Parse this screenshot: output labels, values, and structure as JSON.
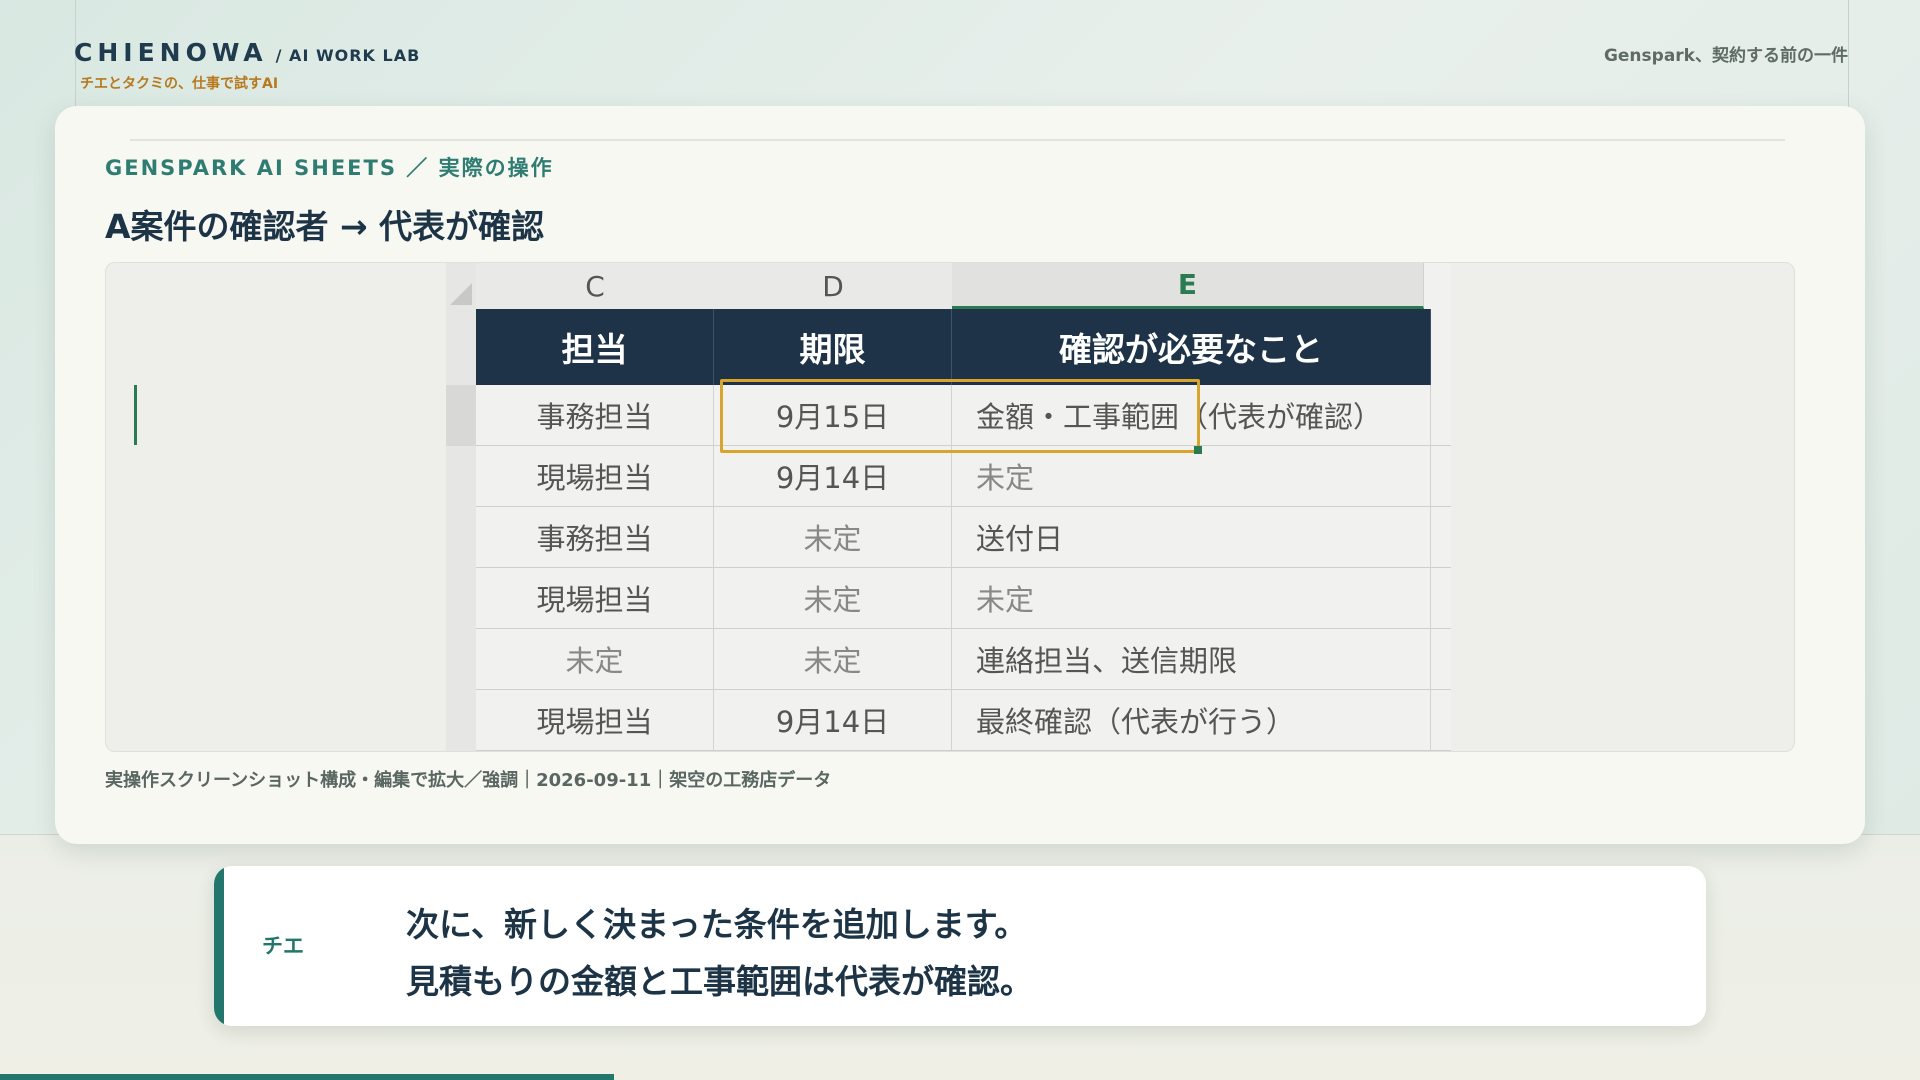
{
  "header": {
    "brand_name": "CHIENOWA",
    "brand_sub": "/ AI WORK LAB",
    "tagline": "チエとタクミの、仕事で試すAI",
    "episode_title": "Genspark、契約する前の一件"
  },
  "slide": {
    "kicker": "GENSPARK AI SHEETS ／ 実際の操作",
    "title": "A案件の確認者 → 代表が確認",
    "caption": "実操作スクリーンショット構成・編集で拡大／強調｜2026-09-11｜架空の工務店データ"
  },
  "sheet": {
    "columns": [
      "C",
      "D",
      "E"
    ],
    "active_column": "E",
    "headers": [
      "担当",
      "期限",
      "確認が必要なこと"
    ],
    "rows": [
      [
        "事務担当",
        "9月15日",
        "金額・工事範囲（代表が確認）"
      ],
      [
        "現場担当",
        "9月14日",
        "未定"
      ],
      [
        "事務担当",
        "未定",
        "送付日"
      ],
      [
        "現場担当",
        "未定",
        "未定"
      ],
      [
        "未定",
        "未定",
        "連絡担当、送信期限"
      ],
      [
        "現場担当",
        "9月14日",
        "最終確認（代表が行う）"
      ]
    ],
    "selected_cell": "E",
    "colors": {
      "header_bg": "#1e3347",
      "selection": "#d9a42c",
      "active": "#2a7a52"
    }
  },
  "speech": {
    "speaker": "チエ",
    "line1": "次に、新しく決まった条件を追加します。",
    "line2": "見積もりの金額と工事範囲は代表が確認。"
  },
  "progress": {
    "fraction": 0.32,
    "color": "#23766b"
  }
}
